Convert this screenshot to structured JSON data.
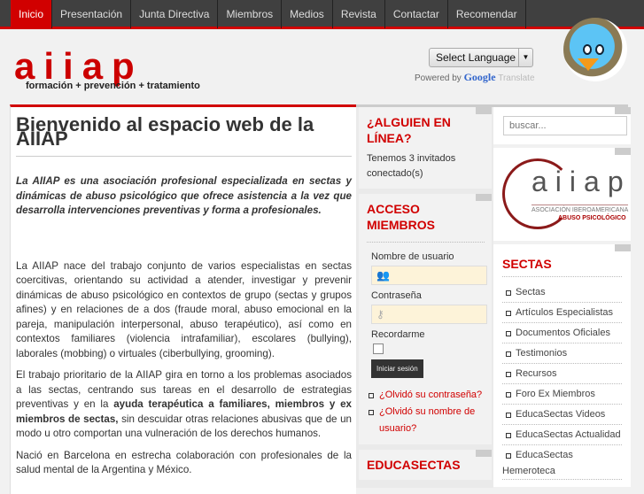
{
  "nav": [
    "Inicio",
    "Presentación",
    "Junta Directiva",
    "Miembros",
    "Medios",
    "Revista",
    "Contactar",
    "Recomendar"
  ],
  "header": {
    "logo": "aiiap",
    "tagline": "formación + prevención + tratamiento",
    "language_select": "Select Language",
    "powered_by": "Powered by",
    "google": "Google",
    "translate": "Translate"
  },
  "main": {
    "title_line1": "Bienvenido al espacio web de la",
    "title_line2": "AIIAP",
    "lead": "La AIIAP es una asociación profesional especializada en sectas y dinámicas de abuso psicológico que ofrece asistencia a la vez que desarrolla intervenciones preventivas y forma a profesionales.",
    "p1": "La AIIAP nace del trabajo conjunto de varios especialistas en sectas coercitivas, orientando su actividad a atender, investigar y prevenir dinámicas de abuso psicológico en contextos de grupo (sectas y grupos afines) y en relaciones de a dos (fraude moral, abuso emocional en la pareja, manipulación interpersonal, abuso terapéutico), así como en contextos familiares (violencia intrafamiliar), escolares (bullying), laborales (mobbing) o virtuales (ciberbullying, grooming).",
    "p2a": "El trabajo prioritario de la AIIAP gira en torno a los problemas asociados a las sectas, centrando sus tareas en el desarrollo de estrategias preventivas y en la ",
    "p2b": "ayuda terapéutica a familiares, miembros y ex miembros de sectas,",
    "p2c": " sin descuidar otras relaciones abusivas que de un modo u otro comportan una vulneración de los derechos humanos.",
    "p3": "Nació en Barcelona en estrecha colaboración con profesionales de la salud mental de la Argentina y México."
  },
  "online": {
    "title": "¿ALGUIEN EN LÍNEA?",
    "text": "Tenemos 3 invitados conectado(s)"
  },
  "login": {
    "title": "ACCESO MIEMBROS",
    "username_label": "Nombre de usuario",
    "password_label": "Contraseña",
    "remember_label": "Recordarme",
    "submit": "Iniciar sesión",
    "forgot_password": "¿Olvidó su contraseña?",
    "forgot_username": "¿Olvidó su nombre de usuario?"
  },
  "educasectas": {
    "title": "EDUCASECTAS"
  },
  "search": {
    "placeholder": "buscar..."
  },
  "side_logo": {
    "text": "aiiap",
    "sub1": "ASOCIACIÓN IBEROAMERICANA",
    "sub2": "ABUSO PSICOLÓGICO"
  },
  "sectas": {
    "title": "SECTAS",
    "items": [
      "Sectas",
      "Artículos Especialistas",
      "Documentos Oficiales",
      "Testimonios",
      "Recursos",
      "Foro Ex Miembros",
      "EducaSectas Videos",
      "EducaSectas Actualidad"
    ],
    "last_a": "EducaSectas",
    "last_b": "Hemeroteca"
  }
}
